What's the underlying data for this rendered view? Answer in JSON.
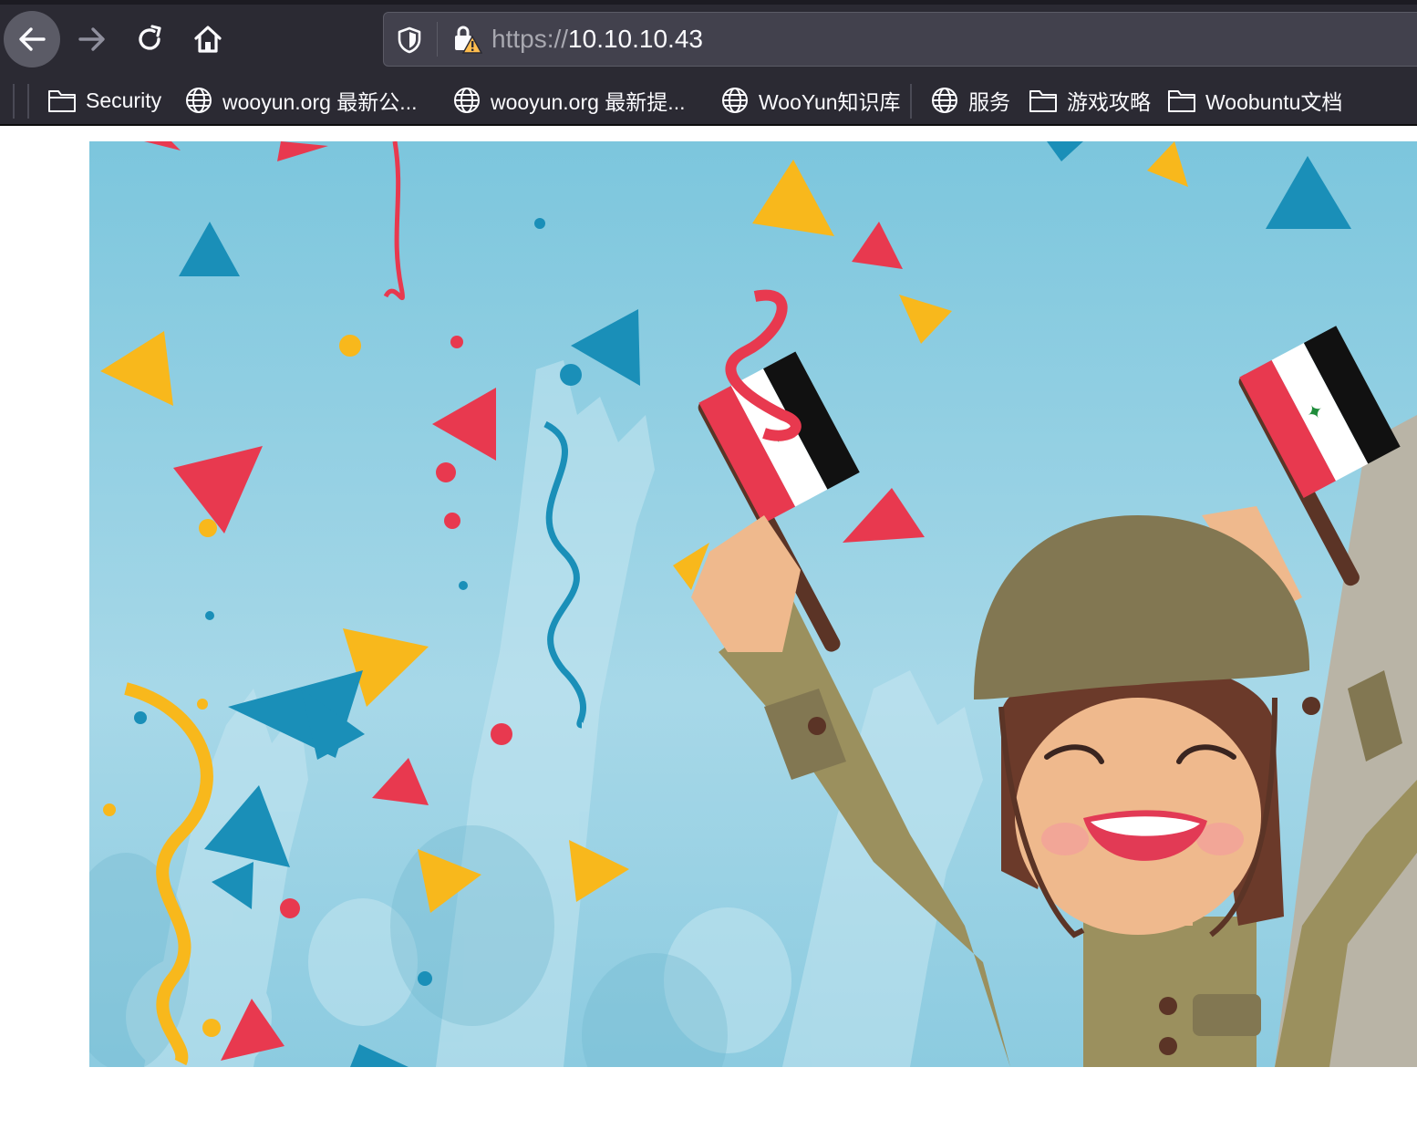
{
  "browser": {
    "url_protocol": "https://",
    "url_host": "10.10.10.43"
  },
  "bookmarks": [
    {
      "label": "Security",
      "icon": "folder-icon"
    },
    {
      "label": "wooyun.org 最新公...",
      "icon": "globe-icon"
    },
    {
      "label": "wooyun.org 最新提...",
      "icon": "globe-icon"
    },
    {
      "label": "WooYun知识库",
      "icon": "globe-icon"
    },
    {
      "label": "服务",
      "icon": "globe-icon"
    },
    {
      "label": "游戏攻略",
      "icon": "folder-icon"
    },
    {
      "label": "Woobuntu文档",
      "icon": "folder-icon"
    }
  ],
  "page": {
    "image": "celebration-illustration"
  },
  "colors": {
    "toolbar_bg": "#2b2a33",
    "urlbar_bg": "#42414d",
    "sky": "#8fcbe0",
    "confetti_blue": "#1a8fb8",
    "confetti_red": "#e8394f",
    "confetti_yellow": "#f8b81c",
    "helmet": "#827752",
    "uniform": "#9b905e",
    "skin": "#efb98d"
  }
}
